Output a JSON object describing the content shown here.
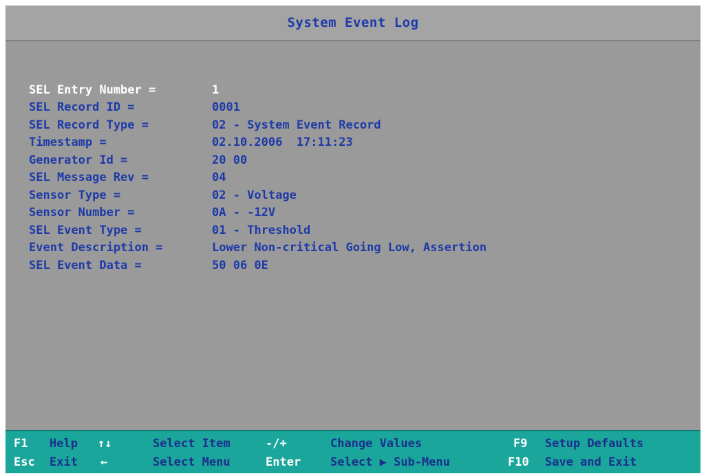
{
  "window": {
    "title": "System Event Log"
  },
  "entries": [
    {
      "label": "SEL Entry Number =",
      "value": "1"
    },
    {
      "label": "SEL Record ID =",
      "value": "0001"
    },
    {
      "label": "SEL Record Type =",
      "value": "02 - System Event Record"
    },
    {
      "label": "Timestamp =",
      "value": "02.10.2006  17:11:23"
    },
    {
      "label": "Generator Id =",
      "value": "20 00"
    },
    {
      "label": "SEL Message Rev =",
      "value": "04"
    },
    {
      "label": "Sensor Type =",
      "value": "02 - Voltage"
    },
    {
      "label": "Sensor Number =",
      "value": "0A - -12V"
    },
    {
      "label": "SEL Event Type =",
      "value": "01 - Threshold"
    },
    {
      "label": "Event Description =",
      "value": "Lower Non-critical Going Low, Assertion"
    },
    {
      "label": "SEL Event Data =",
      "value": "50 06 0E"
    }
  ],
  "help": {
    "row1": [
      {
        "key": "F1",
        "desc": "Help"
      },
      {
        "key": "↑↓",
        "desc": "Select Item"
      },
      {
        "key": "-/+",
        "desc": "Change Values"
      },
      {
        "key": "F9",
        "desc": "Setup Defaults"
      }
    ],
    "row2": [
      {
        "key": "Esc",
        "desc": "Exit"
      },
      {
        "key": "←",
        "desc": "Select Menu"
      },
      {
        "key": "Enter",
        "desc": "Select ▶ Sub-Menu"
      },
      {
        "key": "F10",
        "desc": "Save and Exit"
      }
    ]
  },
  "colors": {
    "background": "#9a9a9a",
    "text_blue": "#1e3aa8",
    "selected_text": "#ffffff",
    "help_bar": "#1aa69a"
  }
}
